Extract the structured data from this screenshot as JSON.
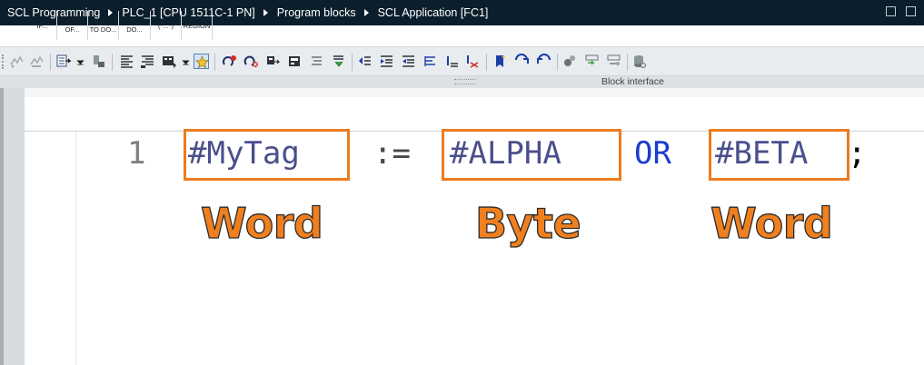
{
  "breadcrumb": {
    "items": [
      "SCL Programming",
      "PLC_1 [CPU 1511C-1 PN]",
      "Program blocks",
      "SCL Application [FC1]"
    ]
  },
  "toolbar": {
    "icons": [
      "monitor-off-icon",
      "monitor-on-icon",
      "insert-block-call-icon",
      "copy-icon",
      "list-indent-icon",
      "list-outdent-icon",
      "display-options-icon",
      "favorites-icon",
      "goto-errors-icon",
      "delete-errors-icon",
      "comment-icon",
      "uncomment-icon",
      "toggle-comment-icon",
      "download-icon",
      "indent-left-icon",
      "indent-right-icon",
      "outdent-icon",
      "align-icon",
      "bookmark-set-icon",
      "bookmark-remove-icon",
      "bookmark-next-icon",
      "bookmark-prev-icon",
      "breakpoint-icon",
      "step-over-icon",
      "step-into-icon",
      "database-icon"
    ]
  },
  "block_interface": {
    "label": "Block interface"
  },
  "snippets": {
    "items": [
      "IF...",
      "CASE...\nOF...",
      "FOR...\nTO DO...",
      "WHILE...\nDO...",
      "(*...*)",
      "REGION"
    ]
  },
  "code": {
    "line_number": "1",
    "target": "#MyTag",
    "assign_op": ":=",
    "operand1": "#ALPHA",
    "keyword": "OR",
    "operand2": "#BETA",
    "terminator": ";"
  },
  "annotations": {
    "target_type": "Word",
    "operand1_type": "Byte",
    "operand2_type": "Word",
    "highlight_color": "#ee7a1d",
    "label_color": "#f07f1e"
  },
  "colors": {
    "titlebar_bg": "#0a1e2c",
    "keyword": "#1a3cd0",
    "variable": "#4a4f8c"
  }
}
